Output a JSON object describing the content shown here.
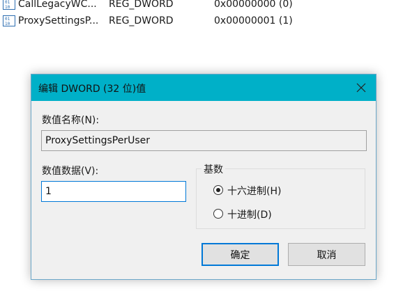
{
  "registry_list": {
    "rows": [
      {
        "name": "CallLegacyWC...",
        "type": "REG_DWORD",
        "data": "0x00000000 (0)"
      },
      {
        "name": "ProxySettingsP...",
        "type": "REG_DWORD",
        "data": "0x00000001 (1)"
      }
    ]
  },
  "dialog": {
    "title": "编辑 DWORD (32 位)值",
    "value_name_label": "数值名称(N):",
    "value_name": "ProxySettingsPerUser",
    "value_data_label": "数值数据(V):",
    "value_data": "1",
    "base_group_label": "基数",
    "radio_hex_label": "十六进制(H)",
    "radio_dec_label": "十进制(D)",
    "selected_base": "hex",
    "ok_label": "确定",
    "cancel_label": "取消"
  },
  "colors": {
    "titlebar": "#00b0c8",
    "dialog_bg": "#f0f0f0",
    "focus_border": "#0078d7",
    "registry_icon": "#2b6cb0"
  },
  "icons": {
    "registry_value": "binary-registry-value-icon",
    "close": "close-icon"
  }
}
